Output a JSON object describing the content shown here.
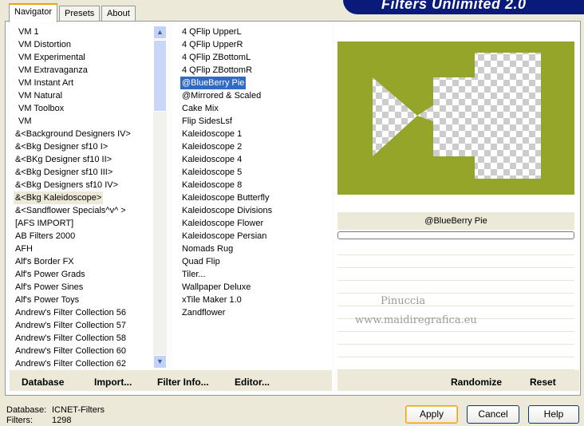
{
  "app": {
    "title": "Filters Unlimited 2.0"
  },
  "tabs": [
    {
      "label": "Navigator"
    },
    {
      "label": "Presets"
    },
    {
      "label": "About"
    }
  ],
  "categories": [
    "VM 1",
    "VM Distortion",
    "VM Experimental",
    "VM Extravaganza",
    "VM Instant Art",
    "VM Natural",
    "VM Toolbox",
    "VM",
    "&<Background Designers IV>",
    "&<Bkg Designer sf10 I>",
    "&<BKg Designer sf10 II>",
    "&<Bkg Designer sf10 III>",
    "&<Bkg Designers sf10 IV>",
    "&<Bkg Kaleidoscope>",
    "&<Sandflower Specials^v^ >",
    "[AFS IMPORT]",
    "AB Filters 2000",
    "AFH",
    "Alf's Border FX",
    "Alf's Power Grads",
    "Alf's Power Sines",
    "Alf's Power Toys",
    "Andrew's Filter Collection 56",
    "Andrew's Filter Collection 57",
    "Andrew's Filter Collection 58",
    "Andrew's Filter Collection 60",
    "Andrew's Filter Collection 62"
  ],
  "selected_category": "&<Bkg Kaleidoscope>",
  "filters": [
    "4 QFlip UpperL",
    "4 QFlip UpperR",
    "4 QFlip ZBottomL",
    "4 QFlip ZBottomR",
    "@BlueBerry Pie",
    "@Mirrored & Scaled",
    "Cake Mix",
    "Flip SidesLsf",
    "Kaleidoscope 1",
    "Kaleidoscope 2",
    "Kaleidoscope 4",
    "Kaleidoscope 5",
    "Kaleidoscope 8",
    "Kaleidoscope Butterfly",
    "Kaleidoscope Divisions",
    "Kaleidoscope Flower",
    "Kaleidoscope Persian",
    "Nomads Rug",
    "Quad Flip",
    "Tiler...",
    "Wallpaper Deluxe",
    "xTile Maker 1.0",
    "Zandflower"
  ],
  "selected_filter": "@BlueBerry Pie",
  "preview": {
    "filter_name": "@BlueBerry Pie",
    "progress": 0,
    "bg_color": "#94a52a"
  },
  "watermark": {
    "line1": "Pinuccia",
    "line2": "www.maidiregrafica.eu"
  },
  "buttons": {
    "database": "Database",
    "import": "Import...",
    "filter_info": "Filter Info...",
    "editor": "Editor...",
    "randomize": "Randomize",
    "reset": "Reset",
    "apply": "Apply",
    "cancel": "Cancel",
    "help": "Help"
  },
  "status": {
    "database_label": "Database:",
    "database_value": "ICNET-Filters",
    "filters_label": "Filters:",
    "filters_value": "1298"
  }
}
